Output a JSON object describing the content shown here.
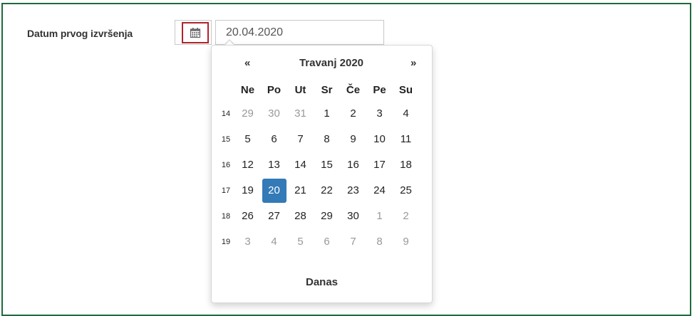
{
  "field": {
    "label": "Datum prvog izvršenja",
    "value": "20.04.2020"
  },
  "calendar_button": {
    "icon": "calendar-icon"
  },
  "datepicker": {
    "prev": "«",
    "next": "»",
    "month_title": "Travanj 2020",
    "weekdays": [
      "Ne",
      "Po",
      "Ut",
      "Sr",
      "Če",
      "Pe",
      "Su"
    ],
    "weeks": [
      {
        "week": "14",
        "days": [
          {
            "d": "29",
            "other": true
          },
          {
            "d": "30",
            "other": true
          },
          {
            "d": "31",
            "other": true
          },
          {
            "d": "1"
          },
          {
            "d": "2"
          },
          {
            "d": "3"
          },
          {
            "d": "4"
          }
        ]
      },
      {
        "week": "15",
        "days": [
          {
            "d": "5"
          },
          {
            "d": "6"
          },
          {
            "d": "7"
          },
          {
            "d": "8"
          },
          {
            "d": "9"
          },
          {
            "d": "10"
          },
          {
            "d": "11"
          }
        ]
      },
      {
        "week": "16",
        "days": [
          {
            "d": "12"
          },
          {
            "d": "13"
          },
          {
            "d": "14"
          },
          {
            "d": "15"
          },
          {
            "d": "16"
          },
          {
            "d": "17"
          },
          {
            "d": "18"
          }
        ]
      },
      {
        "week": "17",
        "days": [
          {
            "d": "19"
          },
          {
            "d": "20",
            "selected": true
          },
          {
            "d": "21"
          },
          {
            "d": "22"
          },
          {
            "d": "23"
          },
          {
            "d": "24"
          },
          {
            "d": "25"
          }
        ]
      },
      {
        "week": "18",
        "days": [
          {
            "d": "26"
          },
          {
            "d": "27"
          },
          {
            "d": "28"
          },
          {
            "d": "29"
          },
          {
            "d": "30"
          },
          {
            "d": "1",
            "other": true
          },
          {
            "d": "2",
            "other": true
          }
        ]
      },
      {
        "week": "19",
        "days": [
          {
            "d": "3",
            "other": true
          },
          {
            "d": "4",
            "other": true
          },
          {
            "d": "5",
            "other": true
          },
          {
            "d": "6",
            "other": true
          },
          {
            "d": "7",
            "other": true
          },
          {
            "d": "8",
            "other": true
          },
          {
            "d": "9",
            "other": true
          }
        ]
      }
    ],
    "today_label": "Danas"
  },
  "colors": {
    "panel_border": "#1e6b3c",
    "button_highlight": "#b0232a",
    "selected_day": "#337ab7"
  }
}
